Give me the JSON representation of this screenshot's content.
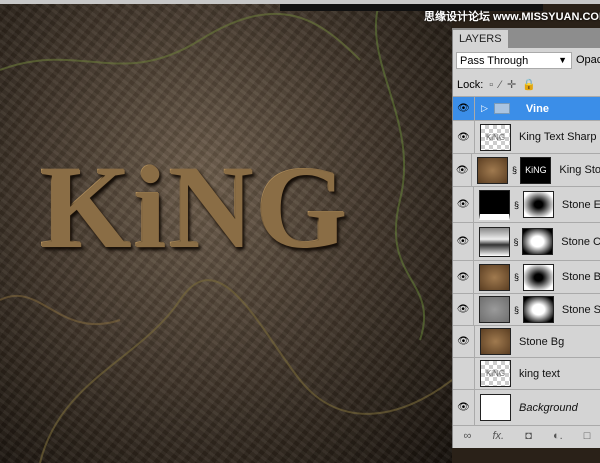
{
  "watermark": "思缘设计论坛 www.MISSYUAN.COM",
  "canvas": {
    "text": "KiNG"
  },
  "panel": {
    "tab": "LAYERS",
    "blend_mode": "Pass Through",
    "opacity_label": "Opac",
    "lock_label": "Lock:"
  },
  "layers": [
    {
      "name": "Vine",
      "visible": true,
      "selected": true,
      "type": "group"
    },
    {
      "name": "King Text Sharp",
      "visible": true,
      "thumb_text": "KiNG"
    },
    {
      "name": "King Sto",
      "visible": true,
      "mask_text": "KiNG"
    },
    {
      "name": "Stone E",
      "visible": true
    },
    {
      "name": "Stone C",
      "visible": true
    },
    {
      "name": "Stone B",
      "visible": true
    },
    {
      "name": "Stone S",
      "visible": true
    },
    {
      "name": "Stone Bg",
      "visible": true
    },
    {
      "name": "king text",
      "visible": false,
      "thumb_text": "KiNG"
    },
    {
      "name": "Background",
      "visible": true
    }
  ],
  "footer": {
    "link": "∞",
    "fx": "fx.",
    "mask": "◘",
    "adjust": "◐.",
    "new": "□"
  }
}
